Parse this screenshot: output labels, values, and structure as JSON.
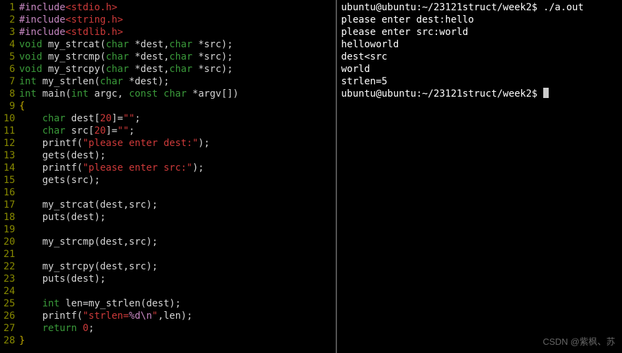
{
  "editor": {
    "lines": [
      {
        "n": "1",
        "tokens": [
          {
            "c": "pre",
            "t": "#include"
          },
          {
            "c": "str",
            "t": "<stdio.h>"
          }
        ]
      },
      {
        "n": "2",
        "tokens": [
          {
            "c": "pre",
            "t": "#include"
          },
          {
            "c": "str",
            "t": "<string.h>"
          }
        ]
      },
      {
        "n": "3",
        "tokens": [
          {
            "c": "pre",
            "t": "#include"
          },
          {
            "c": "str",
            "t": "<stdlib.h>"
          }
        ]
      },
      {
        "n": "4",
        "tokens": [
          {
            "c": "kw",
            "t": "void"
          },
          {
            "c": "ident",
            "t": " my_strcat("
          },
          {
            "c": "kw",
            "t": "char"
          },
          {
            "c": "ident",
            "t": " *dest,"
          },
          {
            "c": "kw",
            "t": "char"
          },
          {
            "c": "ident",
            "t": " *src);"
          }
        ]
      },
      {
        "n": "5",
        "tokens": [
          {
            "c": "kw",
            "t": "void"
          },
          {
            "c": "ident",
            "t": " my_strcmp("
          },
          {
            "c": "kw",
            "t": "char"
          },
          {
            "c": "ident",
            "t": " *dest,"
          },
          {
            "c": "kw",
            "t": "char"
          },
          {
            "c": "ident",
            "t": " *src);"
          }
        ]
      },
      {
        "n": "6",
        "tokens": [
          {
            "c": "kw",
            "t": "void"
          },
          {
            "c": "ident",
            "t": " my_strcpy("
          },
          {
            "c": "kw",
            "t": "char"
          },
          {
            "c": "ident",
            "t": " *dest,"
          },
          {
            "c": "kw",
            "t": "char"
          },
          {
            "c": "ident",
            "t": " *src);"
          }
        ]
      },
      {
        "n": "7",
        "tokens": [
          {
            "c": "kw",
            "t": "int"
          },
          {
            "c": "ident",
            "t": " my_strlen("
          },
          {
            "c": "kw",
            "t": "char"
          },
          {
            "c": "ident",
            "t": " *dest);"
          }
        ]
      },
      {
        "n": "8",
        "tokens": [
          {
            "c": "kw",
            "t": "int"
          },
          {
            "c": "ident",
            "t": " main("
          },
          {
            "c": "kw",
            "t": "int"
          },
          {
            "c": "ident",
            "t": " argc, "
          },
          {
            "c": "kw",
            "t": "const"
          },
          {
            "c": "ident",
            "t": " "
          },
          {
            "c": "kw",
            "t": "char"
          },
          {
            "c": "ident",
            "t": " *argv[])"
          }
        ]
      },
      {
        "n": "9",
        "tokens": [
          {
            "c": "punc",
            "t": "{"
          }
        ]
      },
      {
        "n": "10",
        "tokens": [
          {
            "c": "ident",
            "t": "    "
          },
          {
            "c": "kw",
            "t": "char"
          },
          {
            "c": "ident",
            "t": " dest["
          },
          {
            "c": "num",
            "t": "20"
          },
          {
            "c": "ident",
            "t": "]="
          },
          {
            "c": "str",
            "t": "\"\""
          },
          {
            "c": "ident",
            "t": ";"
          }
        ]
      },
      {
        "n": "11",
        "tokens": [
          {
            "c": "ident",
            "t": "    "
          },
          {
            "c": "kw",
            "t": "char"
          },
          {
            "c": "ident",
            "t": " src["
          },
          {
            "c": "num",
            "t": "20"
          },
          {
            "c": "ident",
            "t": "]="
          },
          {
            "c": "str",
            "t": "\"\""
          },
          {
            "c": "ident",
            "t": ";"
          }
        ]
      },
      {
        "n": "12",
        "tokens": [
          {
            "c": "ident",
            "t": "    printf("
          },
          {
            "c": "str",
            "t": "\"please enter dest:\""
          },
          {
            "c": "ident",
            "t": ");"
          }
        ]
      },
      {
        "n": "13",
        "tokens": [
          {
            "c": "ident",
            "t": "    gets(dest);"
          }
        ]
      },
      {
        "n": "14",
        "tokens": [
          {
            "c": "ident",
            "t": "    printf("
          },
          {
            "c": "str",
            "t": "\"please enter src:\""
          },
          {
            "c": "ident",
            "t": ");"
          }
        ]
      },
      {
        "n": "15",
        "tokens": [
          {
            "c": "ident",
            "t": "    gets(src);"
          }
        ]
      },
      {
        "n": "16",
        "tokens": []
      },
      {
        "n": "17",
        "tokens": [
          {
            "c": "ident",
            "t": "    my_strcat(dest,src);"
          }
        ]
      },
      {
        "n": "18",
        "tokens": [
          {
            "c": "ident",
            "t": "    puts(dest);"
          }
        ]
      },
      {
        "n": "19",
        "tokens": []
      },
      {
        "n": "20",
        "tokens": [
          {
            "c": "ident",
            "t": "    my_strcmp(dest,src);"
          }
        ]
      },
      {
        "n": "21",
        "tokens": []
      },
      {
        "n": "22",
        "tokens": [
          {
            "c": "ident",
            "t": "    my_strcpy(dest,src);"
          }
        ]
      },
      {
        "n": "23",
        "tokens": [
          {
            "c": "ident",
            "t": "    puts(dest);"
          }
        ]
      },
      {
        "n": "24",
        "tokens": []
      },
      {
        "n": "25",
        "tokens": [
          {
            "c": "ident",
            "t": "    "
          },
          {
            "c": "kw",
            "t": "int"
          },
          {
            "c": "ident",
            "t": " len=my_strlen(dest);"
          }
        ]
      },
      {
        "n": "26",
        "tokens": [
          {
            "c": "ident",
            "t": "    printf("
          },
          {
            "c": "str",
            "t": "\"strlen="
          },
          {
            "c": "escape",
            "t": "%d\\n"
          },
          {
            "c": "str",
            "t": "\""
          },
          {
            "c": "ident",
            "t": ",len);"
          }
        ]
      },
      {
        "n": "27",
        "tokens": [
          {
            "c": "ident",
            "t": "    "
          },
          {
            "c": "kw",
            "t": "return"
          },
          {
            "c": "ident",
            "t": " "
          },
          {
            "c": "num",
            "t": "0"
          },
          {
            "c": "ident",
            "t": ";"
          }
        ]
      },
      {
        "n": "28",
        "tokens": [
          {
            "c": "punc",
            "t": "}"
          }
        ]
      }
    ]
  },
  "terminal": {
    "prompt_prefix": "ubuntu@ubuntu:",
    "path": "~/23121struct/week2",
    "sep": "$ ",
    "cmd": "./a.out",
    "out1": "please enter dest:hello",
    "out2": "please enter src:world",
    "out3": "helloworld",
    "out4": "dest<src",
    "out5": "world",
    "out6": "strlen=5"
  },
  "watermark": "CSDN @紫枫、苏"
}
